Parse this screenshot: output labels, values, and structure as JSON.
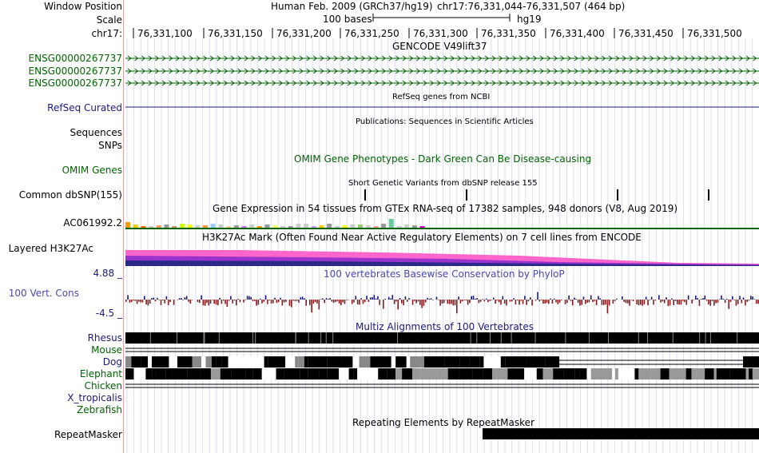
{
  "labels": {
    "window_position": "Window Position",
    "scale": "Scale",
    "chrom": "chr17:",
    "ens1": "ENSG00000267737",
    "ens2": "ENSG00000267737",
    "ens3": "ENSG00000267737",
    "refseq": "RefSeq Curated",
    "sequences": "Sequences",
    "snps": "SNPs",
    "omim": "OMIM Genes",
    "dbsnp": "Common dbSNP(155)",
    "ac": "AC061992.2",
    "h3k27ac": "Layered H3K27Ac",
    "cons_max": "4.88 _",
    "cons": "100 Vert. Cons",
    "cons_min": "-4.5 _",
    "rhesus": "Rhesus",
    "mouse": "Mouse",
    "dog": "Dog",
    "elephant": "Elephant",
    "chicken": "Chicken",
    "xtrop": "X_tropicalis",
    "zebrafish": "Zebrafish",
    "repeatmasker": "RepeatMasker"
  },
  "header": {
    "assembly": "Human Feb. 2009 (GRCh37/hg19)",
    "position": "chr17:76,331,044-76,331,507 (464 bp)",
    "scale_text": "100 bases",
    "db": "hg19"
  },
  "ruler": [
    "76,331,100",
    "76,331,150",
    "76,331,200",
    "76,331,250",
    "76,331,300",
    "76,331,350",
    "76,331,400",
    "76,331,450",
    "76,331,500"
  ],
  "titles": {
    "gencode": "GENCODE V49lift37",
    "refseq": "RefSeq genes from NCBI",
    "pubs": "Publications: Sequences in Scientific Articles",
    "omim": "OMIM Gene Phenotypes - Dark Green Can Be Disease-causing",
    "dbsnp": "Short Genetic Variants from dbSNP release 155",
    "gtex": "Gene Expression in 54 tissues from GTEx RNA-seq of 17382 samples, 948 donors (V8, Aug 2019)",
    "h3k": "H3K27Ac Mark (Often Found Near Active Regulatory Elements) on 7 cell lines from ENCODE",
    "phylop": "100 vertebrates Basewise Conservation by PhyloP",
    "multiz": "Multiz Alignments of 100 Vertebrates",
    "rmsk": "Repeating Elements by RepeatMasker"
  },
  "colors": {
    "gencode": "#006400",
    "omim": "#006400",
    "phylop_pos": "#1a1a7a",
    "phylop_neg": "#8b1a1a",
    "h3k_pink": "#ff66cc",
    "h3k_purple": "#9933cc",
    "h3k_navy": "#2a2a8a",
    "grid": "#dcdcf0",
    "left_border": "#e8a0a0"
  }
}
